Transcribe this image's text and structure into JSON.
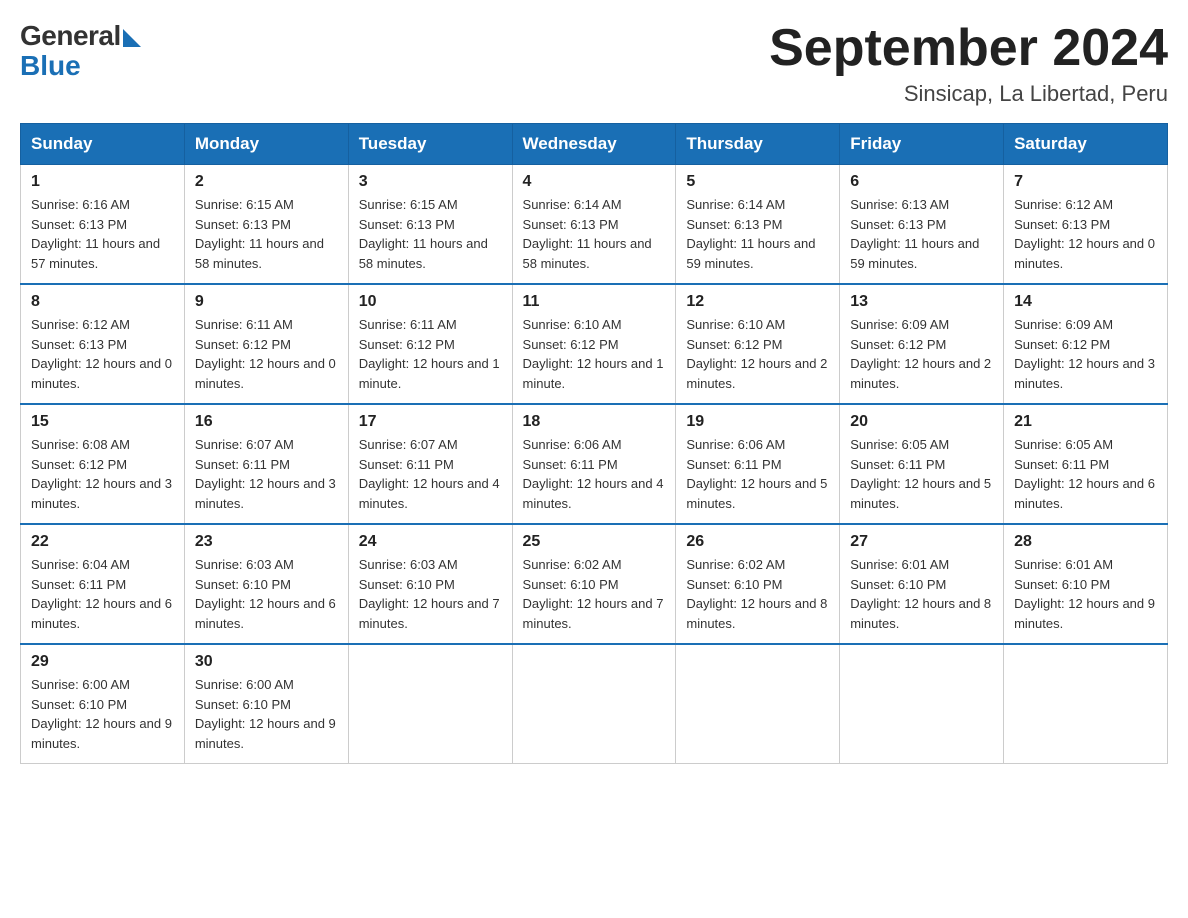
{
  "header": {
    "logo_general": "General",
    "logo_blue": "Blue",
    "title": "September 2024",
    "subtitle": "Sinsicap, La Libertad, Peru"
  },
  "days_of_week": [
    "Sunday",
    "Monday",
    "Tuesday",
    "Wednesday",
    "Thursday",
    "Friday",
    "Saturday"
  ],
  "weeks": [
    [
      {
        "day": "1",
        "sunrise": "6:16 AM",
        "sunset": "6:13 PM",
        "daylight": "11 hours and 57 minutes."
      },
      {
        "day": "2",
        "sunrise": "6:15 AM",
        "sunset": "6:13 PM",
        "daylight": "11 hours and 58 minutes."
      },
      {
        "day": "3",
        "sunrise": "6:15 AM",
        "sunset": "6:13 PM",
        "daylight": "11 hours and 58 minutes."
      },
      {
        "day": "4",
        "sunrise": "6:14 AM",
        "sunset": "6:13 PM",
        "daylight": "11 hours and 58 minutes."
      },
      {
        "day": "5",
        "sunrise": "6:14 AM",
        "sunset": "6:13 PM",
        "daylight": "11 hours and 59 minutes."
      },
      {
        "day": "6",
        "sunrise": "6:13 AM",
        "sunset": "6:13 PM",
        "daylight": "11 hours and 59 minutes."
      },
      {
        "day": "7",
        "sunrise": "6:12 AM",
        "sunset": "6:13 PM",
        "daylight": "12 hours and 0 minutes."
      }
    ],
    [
      {
        "day": "8",
        "sunrise": "6:12 AM",
        "sunset": "6:13 PM",
        "daylight": "12 hours and 0 minutes."
      },
      {
        "day": "9",
        "sunrise": "6:11 AM",
        "sunset": "6:12 PM",
        "daylight": "12 hours and 0 minutes."
      },
      {
        "day": "10",
        "sunrise": "6:11 AM",
        "sunset": "6:12 PM",
        "daylight": "12 hours and 1 minute."
      },
      {
        "day": "11",
        "sunrise": "6:10 AM",
        "sunset": "6:12 PM",
        "daylight": "12 hours and 1 minute."
      },
      {
        "day": "12",
        "sunrise": "6:10 AM",
        "sunset": "6:12 PM",
        "daylight": "12 hours and 2 minutes."
      },
      {
        "day": "13",
        "sunrise": "6:09 AM",
        "sunset": "6:12 PM",
        "daylight": "12 hours and 2 minutes."
      },
      {
        "day": "14",
        "sunrise": "6:09 AM",
        "sunset": "6:12 PM",
        "daylight": "12 hours and 3 minutes."
      }
    ],
    [
      {
        "day": "15",
        "sunrise": "6:08 AM",
        "sunset": "6:12 PM",
        "daylight": "12 hours and 3 minutes."
      },
      {
        "day": "16",
        "sunrise": "6:07 AM",
        "sunset": "6:11 PM",
        "daylight": "12 hours and 3 minutes."
      },
      {
        "day": "17",
        "sunrise": "6:07 AM",
        "sunset": "6:11 PM",
        "daylight": "12 hours and 4 minutes."
      },
      {
        "day": "18",
        "sunrise": "6:06 AM",
        "sunset": "6:11 PM",
        "daylight": "12 hours and 4 minutes."
      },
      {
        "day": "19",
        "sunrise": "6:06 AM",
        "sunset": "6:11 PM",
        "daylight": "12 hours and 5 minutes."
      },
      {
        "day": "20",
        "sunrise": "6:05 AM",
        "sunset": "6:11 PM",
        "daylight": "12 hours and 5 minutes."
      },
      {
        "day": "21",
        "sunrise": "6:05 AM",
        "sunset": "6:11 PM",
        "daylight": "12 hours and 6 minutes."
      }
    ],
    [
      {
        "day": "22",
        "sunrise": "6:04 AM",
        "sunset": "6:11 PM",
        "daylight": "12 hours and 6 minutes."
      },
      {
        "day": "23",
        "sunrise": "6:03 AM",
        "sunset": "6:10 PM",
        "daylight": "12 hours and 6 minutes."
      },
      {
        "day": "24",
        "sunrise": "6:03 AM",
        "sunset": "6:10 PM",
        "daylight": "12 hours and 7 minutes."
      },
      {
        "day": "25",
        "sunrise": "6:02 AM",
        "sunset": "6:10 PM",
        "daylight": "12 hours and 7 minutes."
      },
      {
        "day": "26",
        "sunrise": "6:02 AM",
        "sunset": "6:10 PM",
        "daylight": "12 hours and 8 minutes."
      },
      {
        "day": "27",
        "sunrise": "6:01 AM",
        "sunset": "6:10 PM",
        "daylight": "12 hours and 8 minutes."
      },
      {
        "day": "28",
        "sunrise": "6:01 AM",
        "sunset": "6:10 PM",
        "daylight": "12 hours and 9 minutes."
      }
    ],
    [
      {
        "day": "29",
        "sunrise": "6:00 AM",
        "sunset": "6:10 PM",
        "daylight": "12 hours and 9 minutes."
      },
      {
        "day": "30",
        "sunrise": "6:00 AM",
        "sunset": "6:10 PM",
        "daylight": "12 hours and 9 minutes."
      },
      null,
      null,
      null,
      null,
      null
    ]
  ]
}
